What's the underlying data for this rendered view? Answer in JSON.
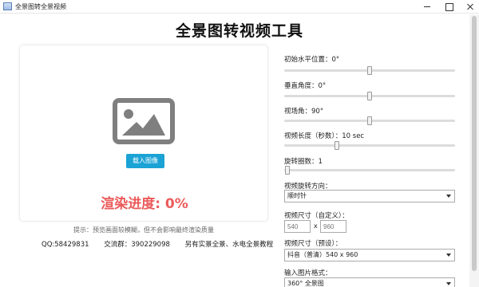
{
  "window": {
    "title": "全景图转全景视频"
  },
  "header": {
    "title": "全景图转视频工具"
  },
  "preview": {
    "load_button": "载入图像",
    "progress_text": "渲染进度: 0%",
    "icon": "image-placeholder-icon"
  },
  "hint": "提示：预览画面较模糊，但不会影响最终渲染质量",
  "contact": {
    "qq": "QQ:58429831",
    "group": "交流群：390229098",
    "tutorial": "另有实景全景、水电全景教程"
  },
  "controls": {
    "start_angle": {
      "label": "初始水平位置：0°",
      "position": 0.5
    },
    "vertical_angle": {
      "label": "垂直角度：0°",
      "position": 0.5
    },
    "fov": {
      "label": "视场角：90°",
      "position": 0.5
    },
    "duration": {
      "label": "视频长度（秒数）：10 sec",
      "position": 0.31
    },
    "rotations": {
      "label": "旋转圈数：1",
      "position": 0.02
    },
    "direction": {
      "label": "视频旋转方向：",
      "value": "顺时针"
    },
    "custom_size": {
      "label": "视频尺寸（自定义）：",
      "width_placeholder": "540",
      "separator": "x",
      "height_placeholder": "960"
    },
    "preset_size": {
      "label": "视频尺寸（预设）：",
      "value": "抖音（普清）540 x 960"
    },
    "input_format": {
      "label": "输入图片格式：",
      "value": "360° 全景图"
    }
  },
  "colors": {
    "accent": "#1ba3d6",
    "progress": "#ec5a5a"
  }
}
